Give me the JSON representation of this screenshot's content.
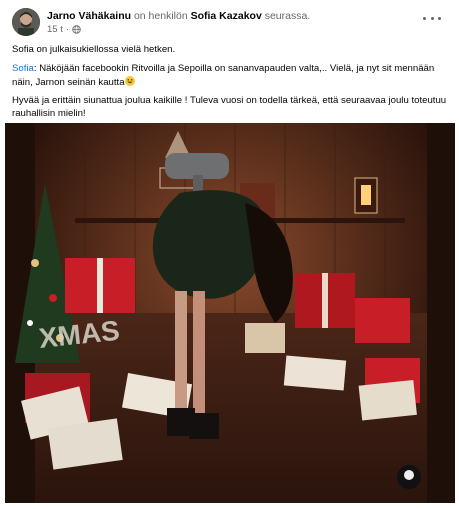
{
  "post": {
    "author": "Jarno Vähäkainu",
    "connector": "on henkilön",
    "tagged": "Sofia Kazakov",
    "tagged_suffix": "seurassa.",
    "time": "15 t",
    "privacy_icon": "globe-icon",
    "more_icon": "more-dots-icon"
  },
  "content": {
    "line1": "Sofia on julkaisukiellossa vielä hetken.",
    "mention": "Sofia",
    "line2_rest": ": Näköjään facebookin Ritvoilla ja Sepoilla on sananvapauden valta,.. Vielä, ja nyt sit mennään näin, Jarnon seinän kautta",
    "emoji": "grinning-face-icon",
    "line3": "Hyvää ja erittäin siunattua joulua kaikille ! Tuleva vuosi on todella tärkeä, että seuraavaa joulu toteutuu rauhallisin mielin!"
  },
  "photo": {
    "sign_text": "XMAS",
    "colors": {
      "wall": "#5a2e1c",
      "floor": "#3a1e13",
      "gift_red": "#c81e28",
      "envelope": "#e9e0d4"
    }
  }
}
